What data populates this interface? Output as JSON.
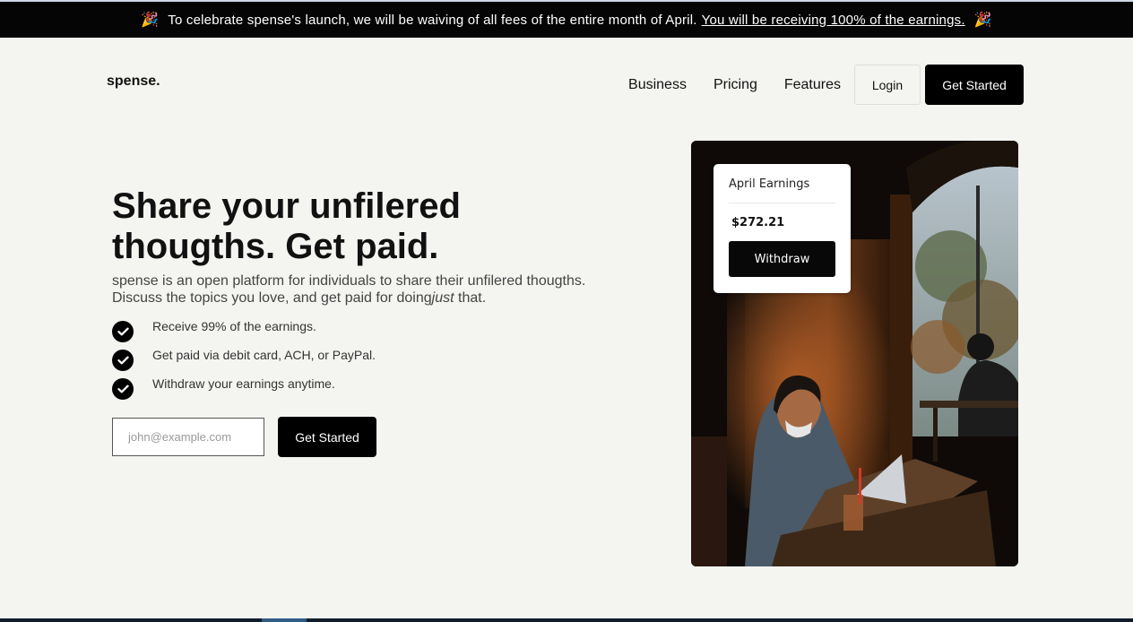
{
  "banner": {
    "text": "To celebrate spense's launch, we will be waiving of all fees of the entire month of April.",
    "link": "You will be receiving 100% of the earnings.",
    "emoji": "🎉"
  },
  "header": {
    "logo": "spense.",
    "nav": [
      "Business",
      "Pricing",
      "Features"
    ],
    "login": "Login",
    "cta": "Get Started"
  },
  "hero": {
    "title": "Share your unfilered thougths. Get paid.",
    "desc_before": "spense is an open platform for individuals to share their unfilered thougths. Discuss the topics you love, and get paid for doing",
    "desc_em": "just",
    "desc_after": " that.",
    "features": [
      "Receive 99% of the earnings.",
      "Get paid via debit card, ACH, or PayPal.",
      "Withdraw your earnings anytime."
    ],
    "email_placeholder": "john@example.com",
    "cta": "Get Started"
  },
  "earnings_card": {
    "title": "April Earnings",
    "amount": "$272.21",
    "button": "Withdraw"
  },
  "icons": {
    "check": "check-icon",
    "party": "party-popper-icon"
  }
}
